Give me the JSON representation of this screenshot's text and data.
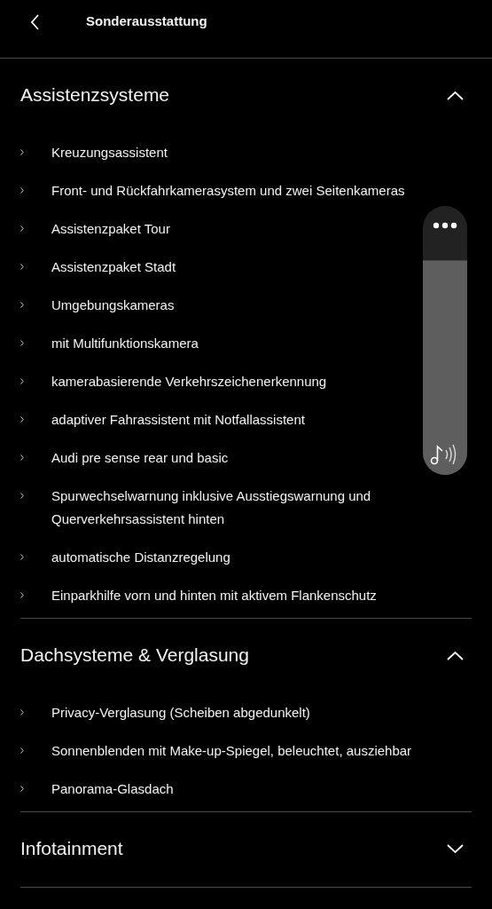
{
  "header": {
    "title": "Sonderausstattung"
  },
  "sections": [
    {
      "title": "Assistenzsysteme",
      "expanded": true,
      "items": [
        "Kreuzungsassistent",
        "Front- und Rückfahrkamerasystem und zwei Seitenkameras",
        "Assistenzpaket Tour",
        "Assistenzpaket Stadt",
        "Umgebungskameras",
        "mit Multifunktionskamera",
        "kamerabasierende Verkehrszeichenerkennung",
        "adaptiver Fahrassistent mit Notfallassistent",
        "Audi pre sense rear und basic",
        "Spurwechselwarnung inklusive Ausstiegswarnung und Querverkehrsassistent hinten",
        "automatische Distanzregelung",
        "Einparkhilfe vorn und hinten mit aktivem Flankenschutz"
      ]
    },
    {
      "title": "Dachsysteme & Verglasung",
      "expanded": true,
      "items": [
        "Privacy-Verglasung (Scheiben abgedunkelt)",
        "Sonnenblenden mit Make-up-Spiegel, beleuchtet, ausziehbar",
        "Panorama-Glasdach"
      ]
    },
    {
      "title": "Infotainment",
      "expanded": false
    }
  ],
  "volume": {
    "level": 0.8
  }
}
